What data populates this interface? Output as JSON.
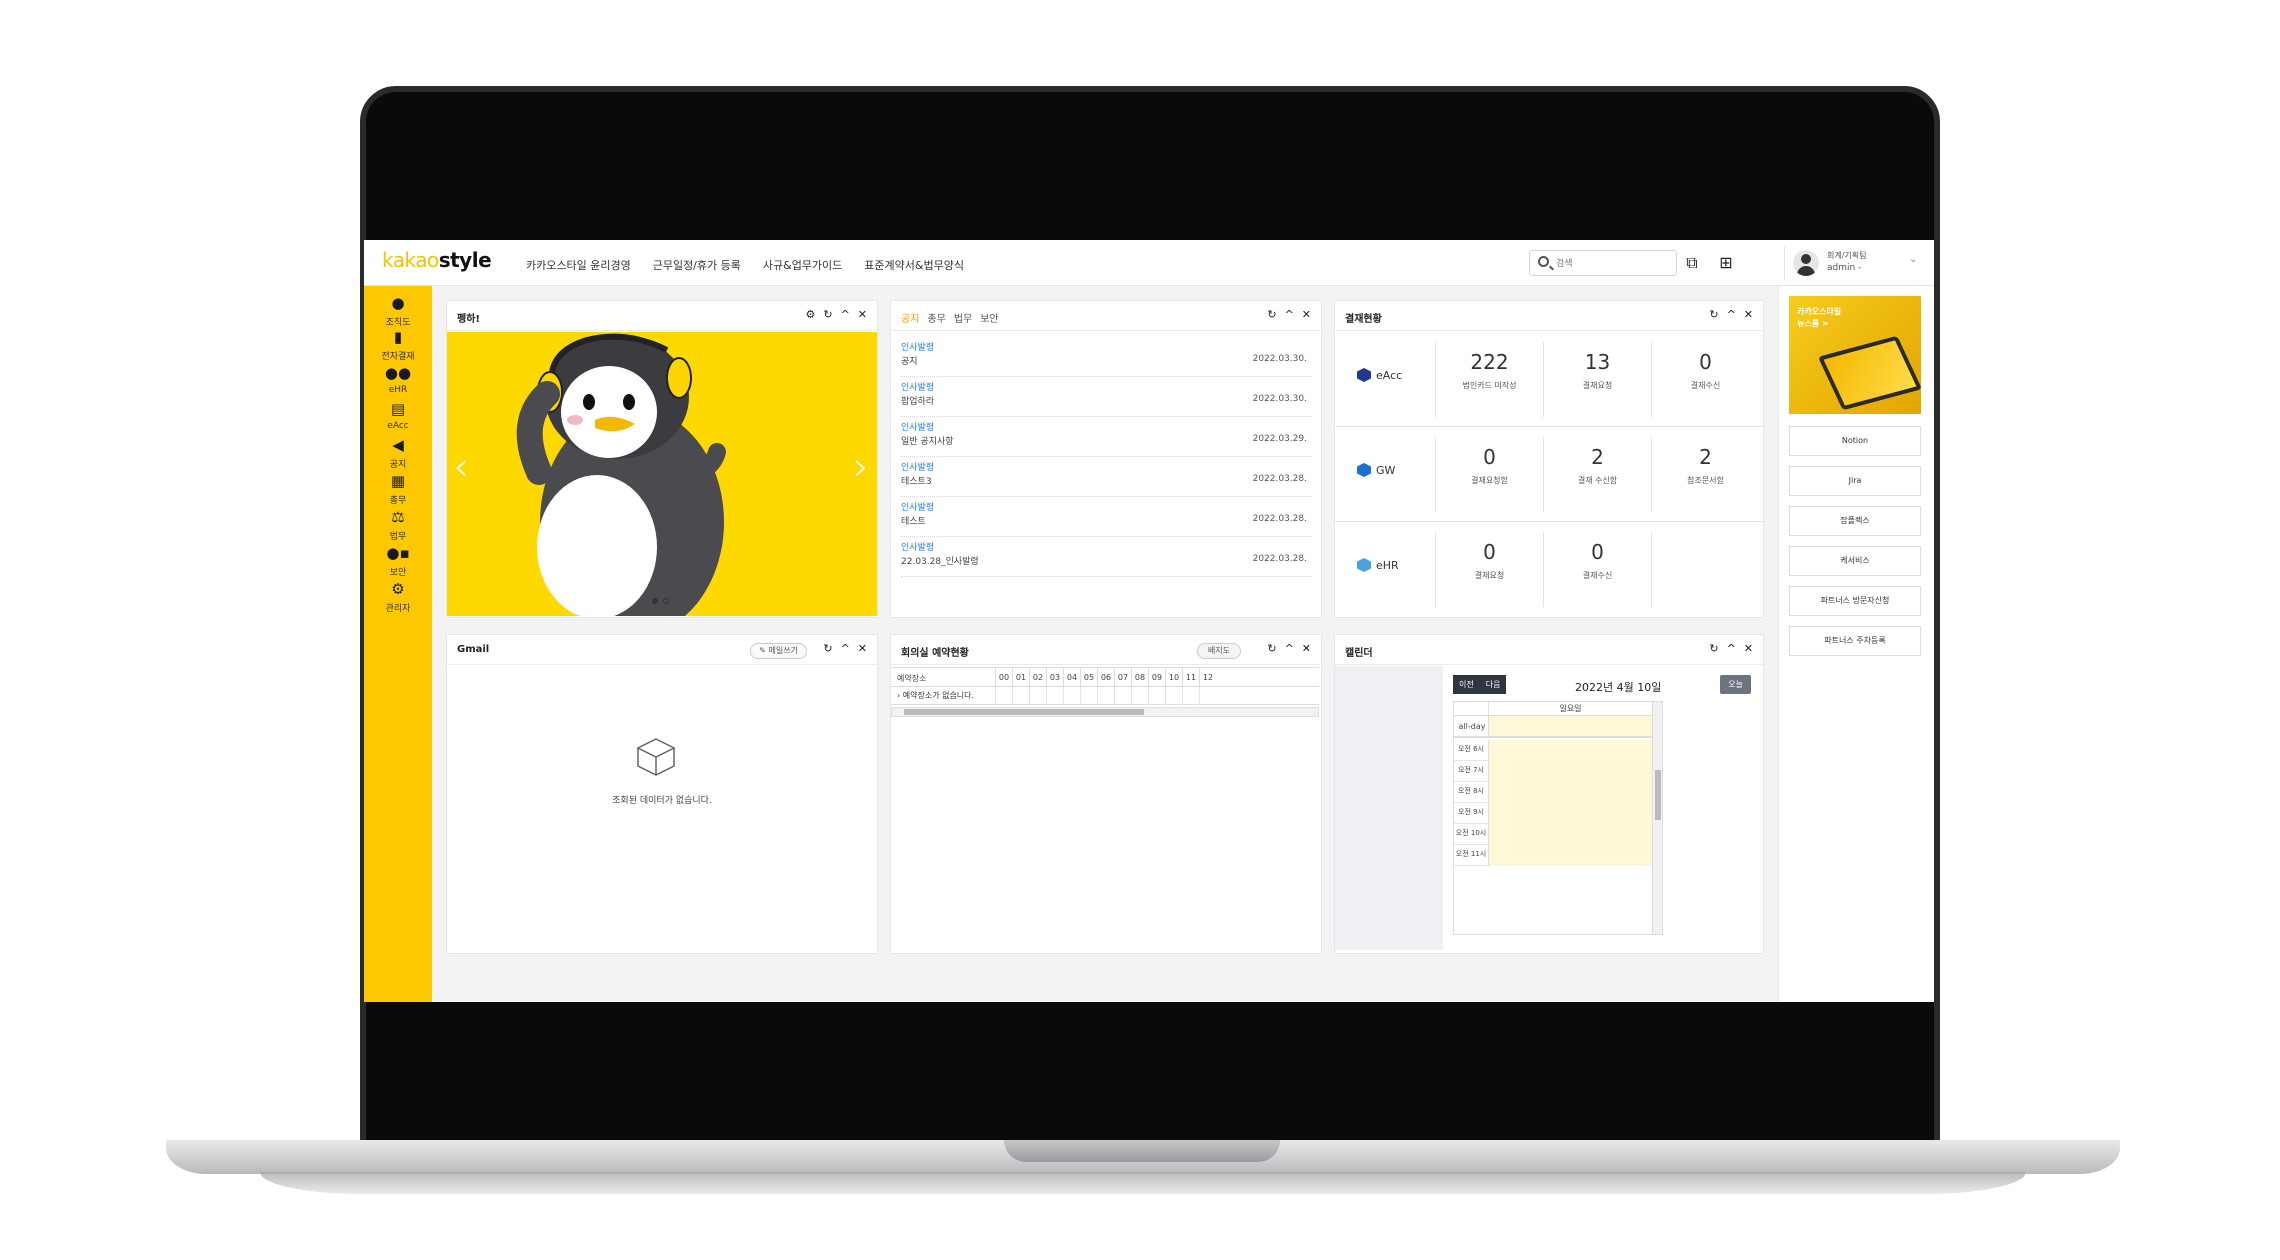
{
  "app": {
    "logo_prefix": "kakao",
    "logo_suffix": "style"
  },
  "topnav": [
    "카카오스타일 윤리경영",
    "근무일정/휴가 등록",
    "사규&업무가이드",
    "표준계약서&법무양식"
  ],
  "search": {
    "placeholder": "검색"
  },
  "user": {
    "dept": "회계/기획팀",
    "name": "admin -"
  },
  "sidebar": [
    {
      "label": "조직도",
      "icon": "person-icon"
    },
    {
      "label": "전자결재",
      "icon": "clipboard-icon"
    },
    {
      "label": "eHR",
      "icon": "people-icon"
    },
    {
      "label": "eAcc",
      "icon": "document-icon"
    },
    {
      "label": "공지",
      "icon": "megaphone-icon"
    },
    {
      "label": "총무",
      "icon": "building-icon"
    },
    {
      "label": "법무",
      "icon": "scale-icon"
    },
    {
      "label": "보안",
      "icon": "user-lock-icon"
    },
    {
      "label": "관리자",
      "icon": "gears-icon"
    }
  ],
  "banner_panel": {
    "title": "펭하!"
  },
  "notice_panel": {
    "tabs": [
      "공지",
      "총무",
      "법무",
      "보안"
    ],
    "active_tab": "공지",
    "items": [
      {
        "category": "인사발령",
        "title": "공지",
        "date": "2022.03.30."
      },
      {
        "category": "인사발령",
        "title": "팝업하라",
        "date": "2022.03.30."
      },
      {
        "category": "인사발령",
        "title": "일반 공지사항",
        "date": "2022.03.29."
      },
      {
        "category": "인사발령",
        "title": "테스트3",
        "date": "2022.03.28."
      },
      {
        "category": "인사발령",
        "title": "테스트",
        "date": "2022.03.28."
      },
      {
        "category": "인사발령",
        "title": "22.03.28_인사발령",
        "date": "2022.03.28."
      }
    ]
  },
  "approval_panel": {
    "title": "결재현황",
    "rows": [
      {
        "system": "eAcc",
        "cells": [
          {
            "value": "222",
            "label": "법인카드 미작성"
          },
          {
            "value": "13",
            "label": "결재요청"
          },
          {
            "value": "0",
            "label": "결재수신"
          }
        ]
      },
      {
        "system": "GW",
        "cells": [
          {
            "value": "0",
            "label": "결재요청함"
          },
          {
            "value": "2",
            "label": "결재 수신함"
          },
          {
            "value": "2",
            "label": "참조문서함"
          }
        ]
      },
      {
        "system": "eHR",
        "cells": [
          {
            "value": "0",
            "label": "결재요청"
          },
          {
            "value": "0",
            "label": "결재수신"
          }
        ]
      }
    ]
  },
  "mail_panel": {
    "title": "Gmail",
    "write_button": "메일쓰기",
    "empty_text": "조회된 데이터가 없습니다."
  },
  "meeting_panel": {
    "title": "회의실 예약현황",
    "badge_button": "배지도",
    "first_col": "예약장소",
    "hours": [
      "00",
      "01",
      "02",
      "03",
      "04",
      "05",
      "06",
      "07",
      "08",
      "09",
      "10",
      "11",
      "12"
    ],
    "empty_row": "예약장소가 없습니다."
  },
  "calendar_panel": {
    "title": "캘린더",
    "prev_button": "이전",
    "next_button": "다음",
    "current_date": "2022년 4월 10일",
    "today_button": "오늘",
    "day_header": "일요일",
    "allday_label": "all-day",
    "hours": [
      "오전 6시",
      "오전 7시",
      "오전 8시",
      "오전 9시",
      "오전 10시",
      "오전 11시"
    ]
  },
  "rightbar": {
    "news_title": "카카오스타일\n뉴스룸 >",
    "links": [
      "Notion",
      "Jira",
      "잡플렉스",
      "케서비스",
      "파트너스 방문자신청",
      "파트너스 주차등록"
    ]
  }
}
